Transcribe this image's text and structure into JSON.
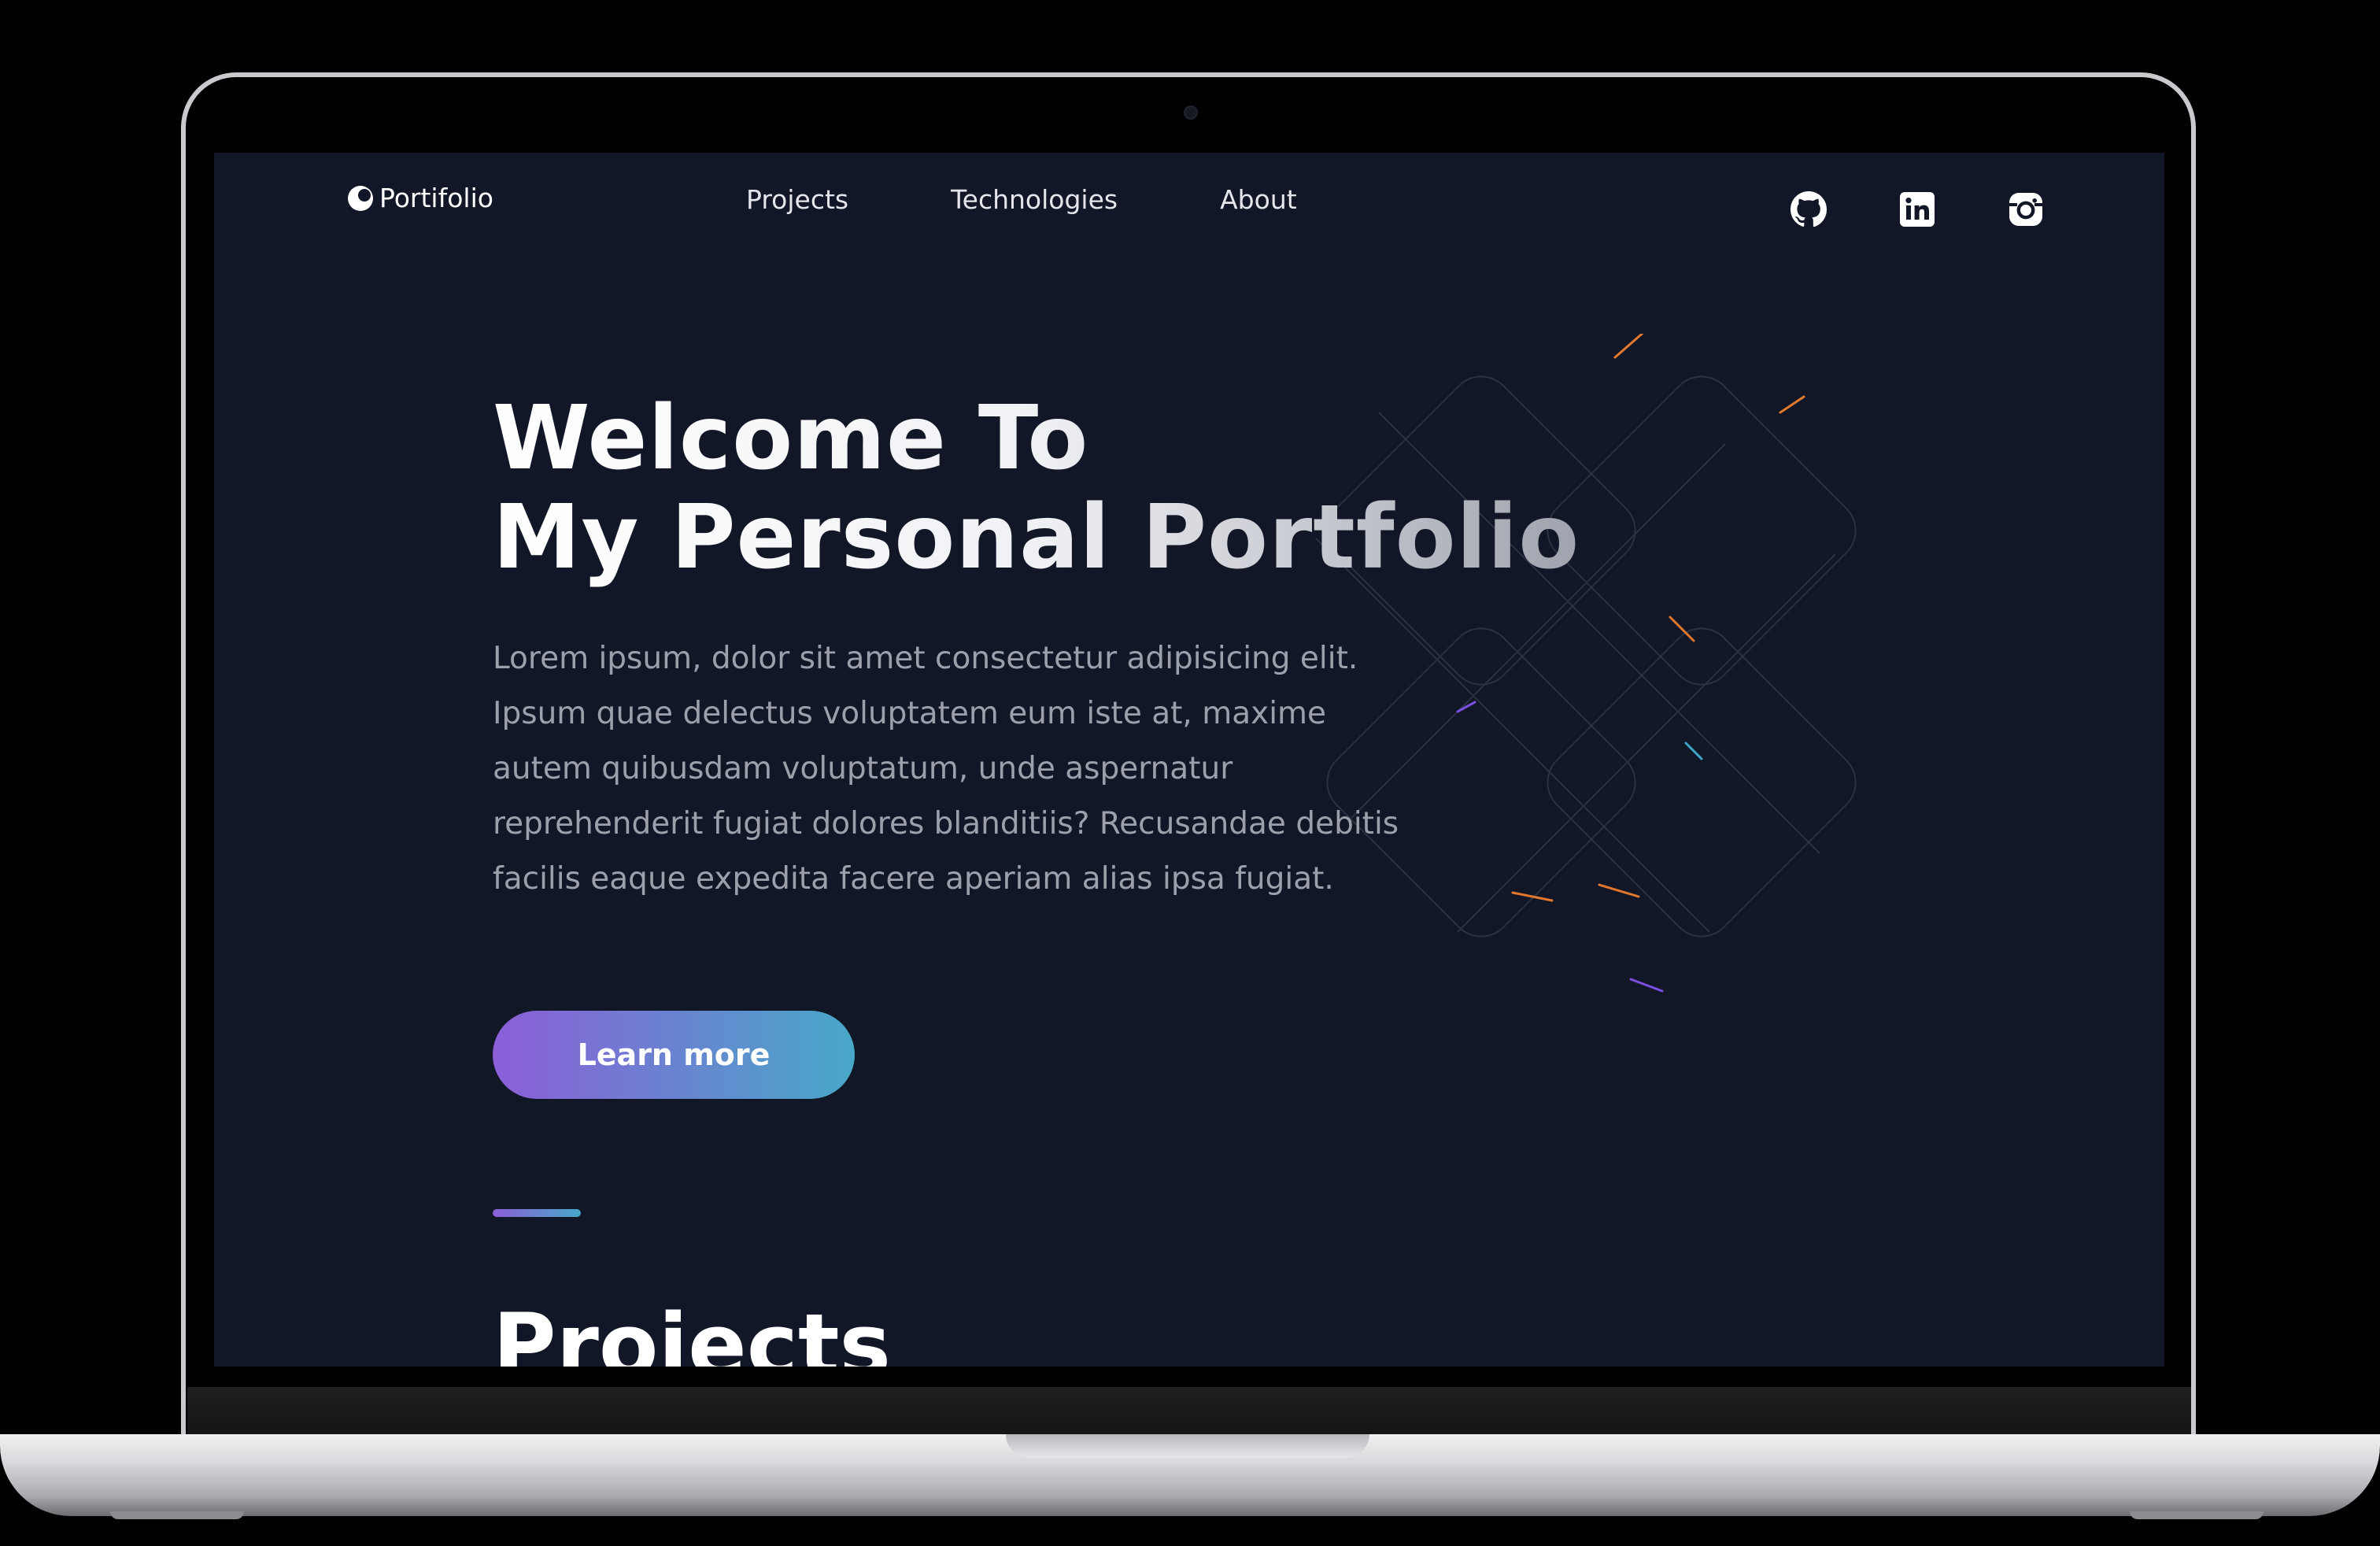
{
  "nav": {
    "logo_text": "Portifolio",
    "links": [
      "Projects",
      "Technologies",
      "About"
    ],
    "social_icons": [
      "github-icon",
      "linkedin-icon",
      "instagram-icon"
    ]
  },
  "hero": {
    "title_line_1": "Welcome To",
    "title_line_2": "My Personal Portfolio",
    "description": "Lorem ipsum, dolor sit amet consectetur adipisicing elit. Ipsum quae delectus voluptatem eum iste at, maxime autem quibusdam voluptatum, unde aspernatur reprehenderit fugiat dolores blanditiis? Recusandae debitis facilis eaque expedita facere aperiam alias ipsa fugiat.",
    "cta_label": "Learn more"
  },
  "projects": {
    "heading": "Projects"
  },
  "colors": {
    "background": "#111727",
    "gradient_start": "#8c5ed8",
    "gradient_end": "#47a8c8",
    "text_muted": "#9ca0ab"
  }
}
